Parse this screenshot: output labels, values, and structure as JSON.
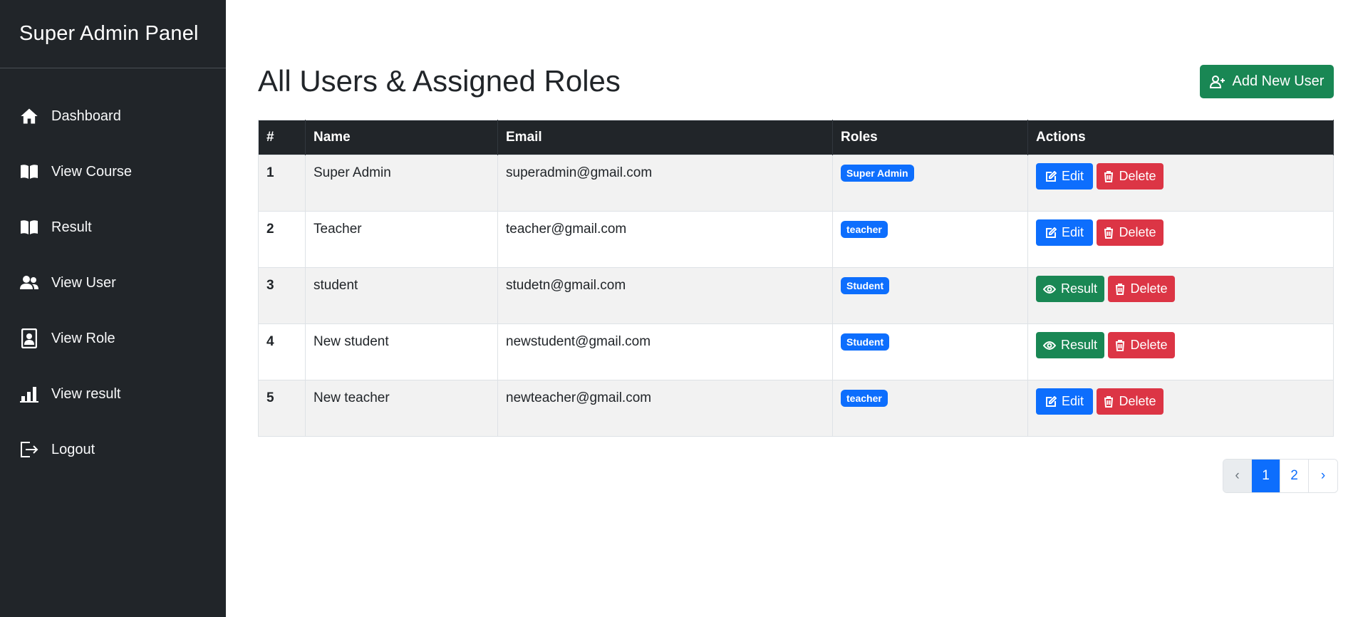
{
  "sidebar": {
    "brand": "Super Admin Panel",
    "items": [
      {
        "label": "Dashboard",
        "icon": "house-icon"
      },
      {
        "label": "View Course",
        "icon": "book-icon"
      },
      {
        "label": "Result",
        "icon": "book-icon"
      },
      {
        "label": "View User",
        "icon": "users-icon"
      },
      {
        "label": "View Role",
        "icon": "id-badge-icon"
      },
      {
        "label": "View result",
        "icon": "bar-chart-icon"
      },
      {
        "label": "Logout",
        "icon": "logout-icon"
      }
    ]
  },
  "main": {
    "title": "All Users & Assigned Roles",
    "add_button": "Add New User",
    "table": {
      "headers": [
        "#",
        "Name",
        "Email",
        "Roles",
        "Actions"
      ],
      "rows": [
        {
          "num": "1",
          "name": "Super Admin",
          "email": "superadmin@gmail.com",
          "role": "Super Admin",
          "primary_action": "Edit",
          "delete": "Delete"
        },
        {
          "num": "2",
          "name": "Teacher",
          "email": "teacher@gmail.com",
          "role": "teacher",
          "primary_action": "Edit",
          "delete": "Delete"
        },
        {
          "num": "3",
          "name": "student",
          "email": "studetn@gmail.com",
          "role": "Student",
          "primary_action": "Result",
          "delete": "Delete"
        },
        {
          "num": "4",
          "name": "New student",
          "email": "newstudent@gmail.com",
          "role": "Student",
          "primary_action": "Result",
          "delete": "Delete"
        },
        {
          "num": "5",
          "name": "New teacher",
          "email": "newteacher@gmail.com",
          "role": "teacher",
          "primary_action": "Edit",
          "delete": "Delete"
        }
      ]
    },
    "pagination": {
      "prev": "‹",
      "pages": [
        "1",
        "2"
      ],
      "current": "1",
      "next": "›"
    }
  },
  "colors": {
    "sidebar_bg": "#212529",
    "primary": "#0d6efd",
    "success": "#198754",
    "danger": "#dc3545"
  }
}
